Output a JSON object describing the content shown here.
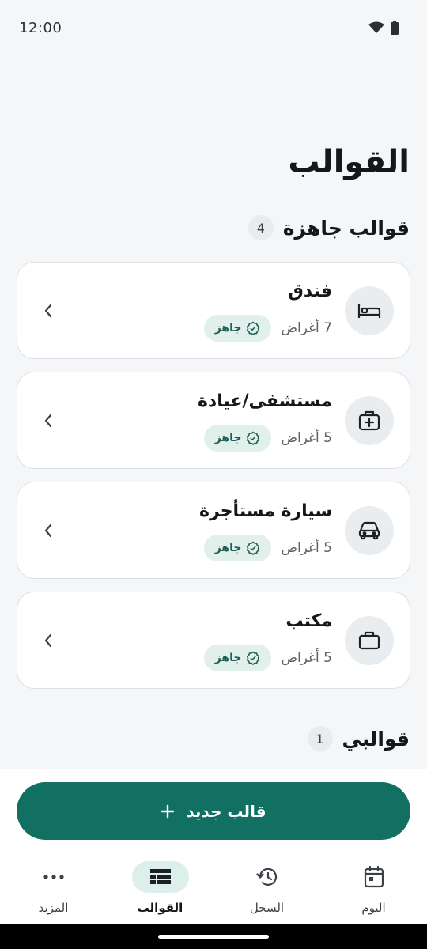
{
  "status": {
    "time": "12:00"
  },
  "page": {
    "title": "القوالب"
  },
  "ready_section": {
    "title": "قوالب جاهزة",
    "count": "4",
    "cards": [
      {
        "title": "فندق",
        "items": "7 أغراض",
        "badge": "جاهز",
        "icon": "bed-icon"
      },
      {
        "title": "مستشفى/عيادة",
        "items": "5 أغراض",
        "badge": "جاهز",
        "icon": "medical-kit-icon"
      },
      {
        "title": "سيارة مستأجرة",
        "items": "5 أغراض",
        "badge": "جاهز",
        "icon": "car-icon"
      },
      {
        "title": "مكتب",
        "items": "5 أغراض",
        "badge": "جاهز",
        "icon": "briefcase-icon"
      }
    ]
  },
  "my_section": {
    "title": "قوالبي",
    "count": "1"
  },
  "new_button": {
    "label": "قالب جديد",
    "icon": "plus-icon"
  },
  "nav": {
    "today": "اليوم",
    "history": "السجل",
    "templates": "القوالب",
    "more": "المزيد"
  },
  "colors": {
    "accent": "#127063",
    "badge_bg": "#e2f0ec",
    "background": "#f4f6f8"
  }
}
